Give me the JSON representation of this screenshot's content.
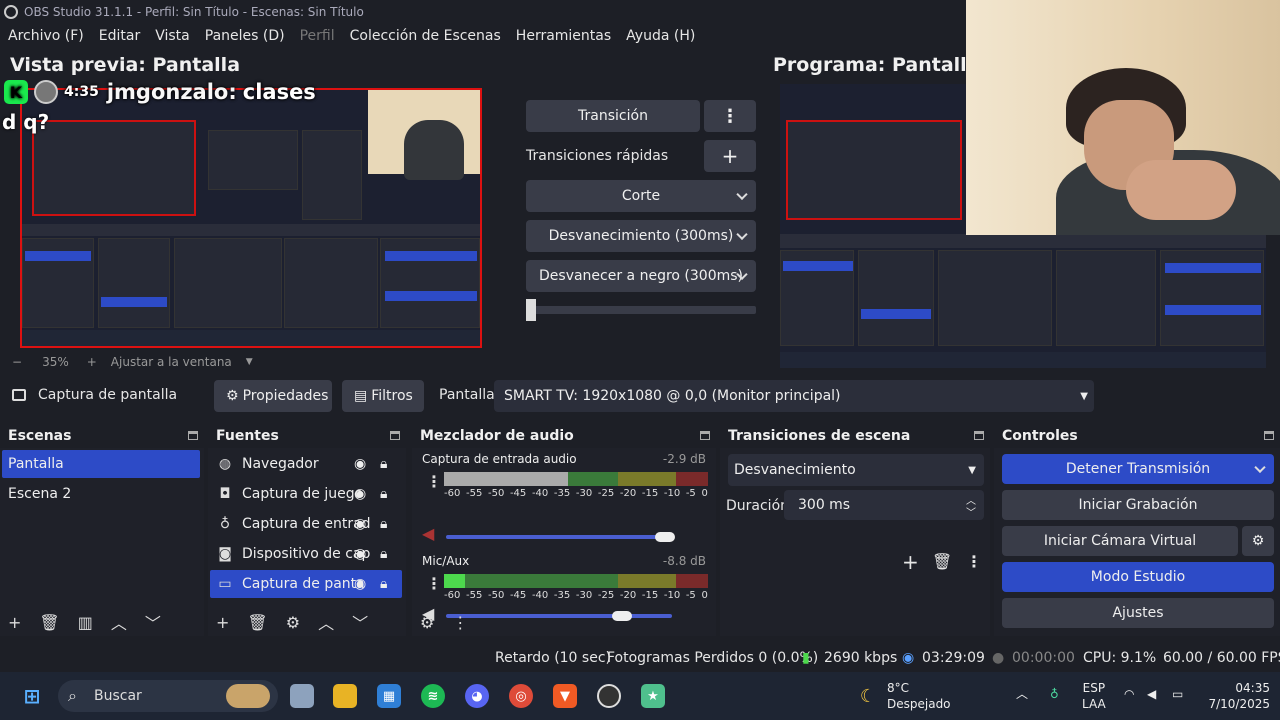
{
  "window": {
    "title": "OBS Studio 31.1.1 - Perfil: Sin Título - Escenas: Sin Título"
  },
  "menu": [
    "Archivo (F)",
    "Editar",
    "Vista",
    "Paneles (D)",
    "Perfil",
    "Colección de Escenas",
    "Herramientas",
    "Ayuda (H)"
  ],
  "preview": {
    "title": "Vista previa: Pantalla",
    "program_title": "Programa: Pantalla",
    "zoom": "35%",
    "zoom_minus": "−",
    "zoom_plus": "+",
    "fit_label": "Ajustar a la ventana"
  },
  "chat": {
    "badge": "K",
    "time": "4:35",
    "user": "jmgonzalo:",
    "message": "clases",
    "message_cont": "d q?"
  },
  "transition_panel": {
    "transition_button": "Transición",
    "quick_label": "Transiciones rápidas",
    "items": [
      "Corte",
      "Desvanecimiento (300ms)",
      "Desvanecer a negro (300ms)"
    ]
  },
  "source_bar": {
    "source_name": "Captura de pantalla",
    "properties": "Propiedades",
    "filters": "Filtros",
    "display_label": "Pantalla",
    "display_value": "SMART TV: 1920x1080 @ 0,0 (Monitor principal)"
  },
  "scenes": {
    "title": "Escenas",
    "items": [
      "Pantalla",
      "Escena 2"
    ]
  },
  "sources": {
    "title": "Fuentes",
    "items": [
      "Navegador",
      "Captura de juego",
      "Captura de entrad",
      "Dispositivo de cap",
      "Captura de panta"
    ]
  },
  "mixer": {
    "title": "Mezclador de audio",
    "channels": [
      {
        "name": "Captura de entrada audio",
        "db": "-2.9 dB",
        "level": 0.47,
        "volume": 0.97
      },
      {
        "name": "Mic/Aux",
        "db": "-8.8 dB",
        "level": 0.08,
        "volume": 0.78
      }
    ],
    "scale": [
      "-60",
      "-55",
      "-50",
      "-45",
      "-40",
      "-35",
      "-30",
      "-25",
      "-20",
      "-15",
      "-10",
      "-5",
      "0"
    ]
  },
  "scene_transitions": {
    "title": "Transiciones de escena",
    "selected": "Desvanecimiento",
    "duration_label": "Duración",
    "duration_value": "300 ms"
  },
  "controls": {
    "title": "Controles",
    "stop_stream": "Detener Transmisión",
    "start_recording": "Iniciar Grabación",
    "start_virtualcam": "Iniciar Cámara Virtual",
    "studio_mode": "Modo Estudio",
    "settings": "Ajustes"
  },
  "status": {
    "delay": "Retardo (10 sec)",
    "dropped": "Fotogramas Perdidos 0 (0.0%)",
    "bitrate": "2690 kbps",
    "stream_time": "03:29:09",
    "rec_time": "00:00:00",
    "cpu": "CPU: 9.1%",
    "fps": "60.00 / 60.00 FPS"
  },
  "taskbar": {
    "search": "Buscar",
    "weather_temp": "8°C",
    "weather_desc": "Despejado",
    "lang": "ESP",
    "lang_sub": "LAA",
    "time": "04:35",
    "date": "7/10/2025"
  },
  "colors": {
    "accent": "#2d4bc7",
    "preview_border": "#d11111",
    "meter_green": "#4dd94d",
    "bg": "#1d1f26"
  }
}
